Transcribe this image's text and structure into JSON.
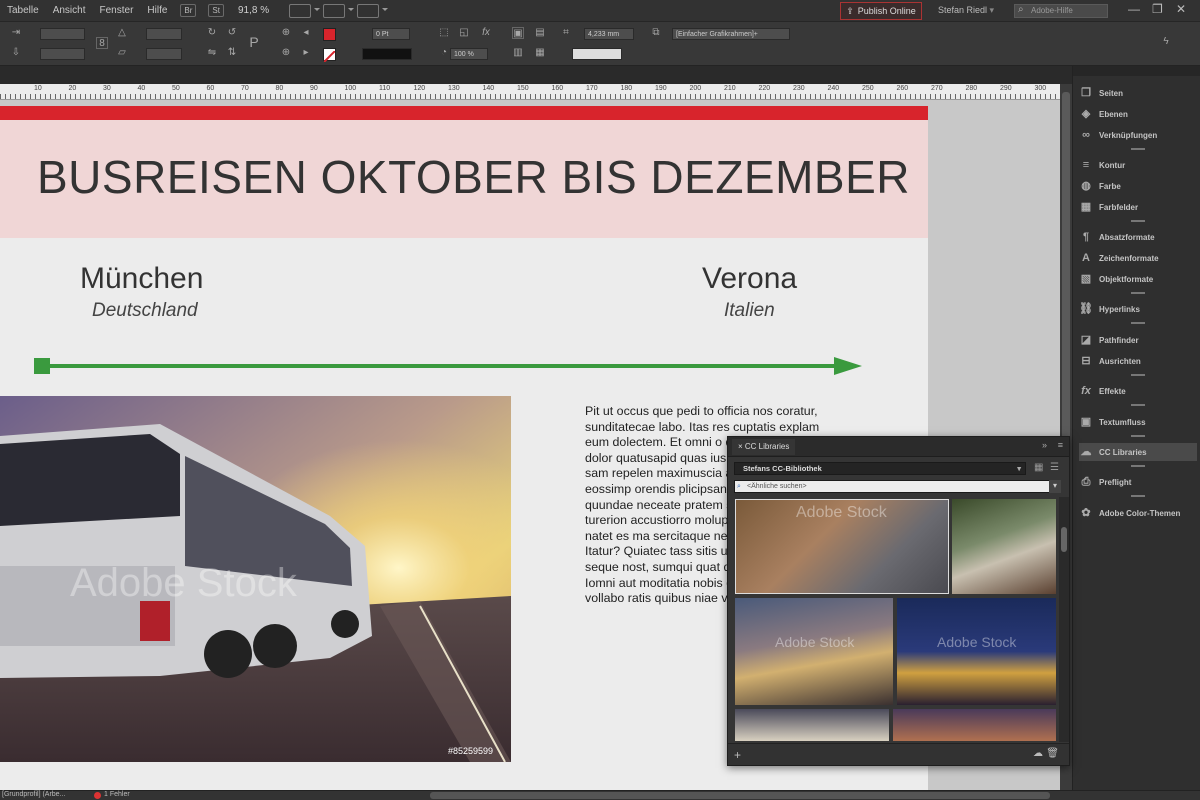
{
  "menubar": {
    "items": [
      "Tabelle",
      "Ansicht",
      "Fenster",
      "Hilfe"
    ],
    "badge_br": "Br",
    "badge_st": "St",
    "zoom": "91,8 %",
    "publish_label": "Publish Online",
    "user_name": "Stefan Riedl",
    "help_search_placeholder": "Adobe-Hilfe"
  },
  "control": {
    "stroke_weight": "0 Pt",
    "opacity": "100 %",
    "dimension": "4,233 mm",
    "frame_style": "[Einfacher Grafikrahmen]+",
    "fill_color": "#d8242c"
  },
  "ruler": {
    "ticks": [
      "10",
      "20",
      "30",
      "40",
      "50",
      "60",
      "70",
      "80",
      "90",
      "100",
      "110",
      "120",
      "130",
      "140",
      "150",
      "160",
      "170",
      "180",
      "190",
      "200",
      "210",
      "220",
      "230",
      "240",
      "250",
      "260",
      "270",
      "280",
      "290",
      "300"
    ]
  },
  "document": {
    "headline": "BUSREISEN OKTOBER BIS DEZEMBER",
    "origin_city": "München",
    "origin_country": "Deutschland",
    "dest_city": "Verona",
    "dest_country": "Italien",
    "route_color": "#3a9a3e",
    "photo_watermark": "Adobe Stock",
    "photo_id": "#85259599",
    "body_text": "Pit ut occus que pedi to officia nos coratur, sunditatecae labo. Itas res cuptatis explam eum dolectem. Et omni o quam doluptae asi dolor quatusapid quas ius volo apitiaectur sam repelen maximuscia acessit odig acilitae eossimp orendis plicipsant lam earuptiat quundae neceate pratem simet odi incilic turerion accustiorro moluptatam quatur sanda natet es ma sercitaque necum conse tem. Itatur? Quiatec tass sitis ut ute nihil isque nin seque nost, sumqui quat quo inusae nitam, Iomni aut moditatia nobis ga optatibeate vollabo ratis quibus niae voluptat quo"
  },
  "panels": {
    "items": [
      "Seiten",
      "Ebenen",
      "Verknüpfungen",
      "Kontur",
      "Farbe",
      "Farbfelder",
      "Absatzformate",
      "Zeichenformate",
      "Objektformate",
      "Hyperlinks",
      "Pathfinder",
      "Ausrichten",
      "Effekte",
      "Textumfluss",
      "CC Libraries",
      "Preflight",
      "Adobe Color-Themen"
    ],
    "active": "CC Libraries"
  },
  "cc_libraries": {
    "tab_label": "CC Libraries",
    "library_name": "Stefans CC-Bibliothek",
    "search_placeholder": "<Ähnliche suchen>",
    "watermark": "Adobe Stock"
  },
  "status": {
    "profile": "[Grundprofil] (Arbe...",
    "errors": "1 Fehler"
  }
}
